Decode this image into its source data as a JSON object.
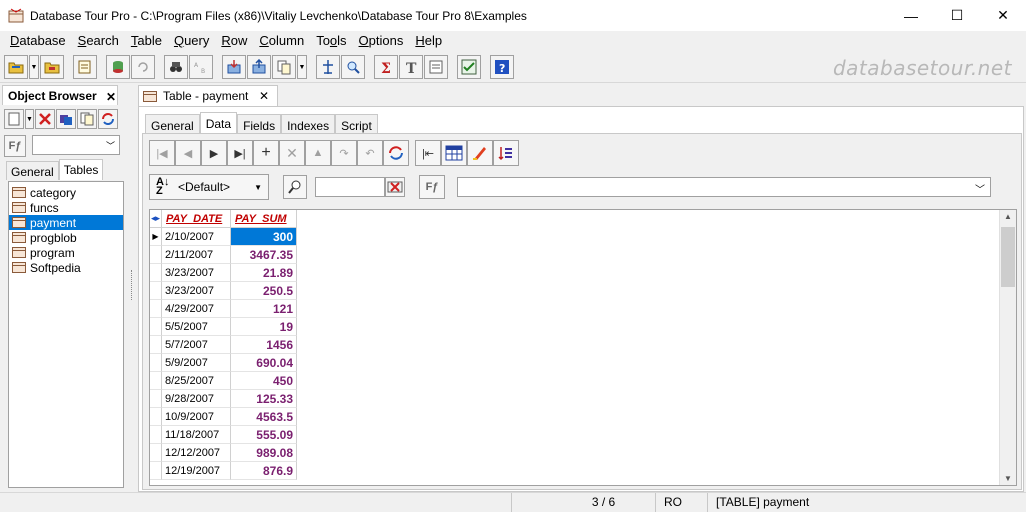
{
  "window": {
    "title": "Database Tour Pro - C:\\Program Files (x86)\\Vitaliy Levchenko\\Database Tour Pro 8\\Examples",
    "minimize": "—",
    "maximize": "☐",
    "close": "✕"
  },
  "menu": {
    "items": [
      {
        "u": "D",
        "rest": "atabase"
      },
      {
        "u": "S",
        "rest": "earch"
      },
      {
        "u": "T",
        "rest": "able"
      },
      {
        "u": "Q",
        "rest": "uery"
      },
      {
        "u": "R",
        "rest": "ow"
      },
      {
        "u": "C",
        "rest": "olumn"
      },
      {
        "pre": "To",
        "u": "o",
        "rest": "ls"
      },
      {
        "u": "O",
        "rest": "ptions"
      },
      {
        "u": "H",
        "rest": "elp"
      }
    ]
  },
  "brand": "databasetour.net",
  "object_browser": {
    "title": "Object Browser",
    "close": "✕",
    "tabs": [
      "General",
      "Tables"
    ],
    "active_tab": "Tables",
    "items": [
      "category",
      "funcs",
      "payment",
      "progblob",
      "program",
      "Softpedia"
    ],
    "selected": "payment"
  },
  "document": {
    "tab_label": "Table - payment",
    "close": "✕",
    "tabs": [
      "General",
      "Data",
      "Fields",
      "Indexes",
      "Script"
    ],
    "active_tab": "Data"
  },
  "filter": {
    "sort_label": "<Default>",
    "fx_label": "Fƒ"
  },
  "grid": {
    "columns": [
      "PAY_DATE",
      "PAY_SUM"
    ],
    "rows": [
      [
        "2/10/2007",
        "300"
      ],
      [
        "2/11/2007",
        "3467.35"
      ],
      [
        "3/23/2007",
        "21.89"
      ],
      [
        "3/23/2007",
        "250.5"
      ],
      [
        "4/29/2007",
        "121"
      ],
      [
        "5/5/2007",
        "19"
      ],
      [
        "5/7/2007",
        "1456"
      ],
      [
        "5/9/2007",
        "690.04"
      ],
      [
        "8/25/2007",
        "450"
      ],
      [
        "9/28/2007",
        "125.33"
      ],
      [
        "10/9/2007",
        "4563.5"
      ],
      [
        "11/18/2007",
        "555.09"
      ],
      [
        "12/12/2007",
        "989.08"
      ],
      [
        "12/19/2007",
        "876.9"
      ]
    ],
    "current_row": 0
  },
  "status": {
    "position": "3 / 6",
    "mode": "RO",
    "object": "[TABLE] payment"
  }
}
